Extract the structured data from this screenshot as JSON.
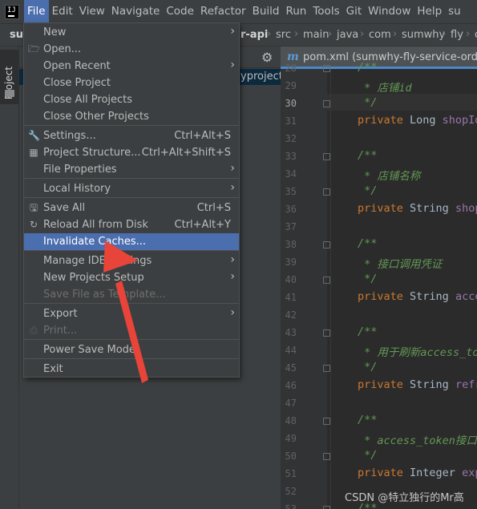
{
  "menubar": {
    "items": [
      "File",
      "Edit",
      "View",
      "Navigate",
      "Code",
      "Refactor",
      "Build",
      "Run",
      "Tools",
      "Git",
      "Window",
      "Help",
      "su"
    ],
    "active": "File"
  },
  "navbar": {
    "project": "su",
    "module": "r-api",
    "crumbs": [
      "src",
      "main",
      "java",
      "com",
      "sumwhy",
      "fly",
      "c"
    ]
  },
  "toolstrip": {
    "project_tab": "Project"
  },
  "project_panel": {
    "selected_row_text": "yproject\\"
  },
  "editor_tab": {
    "name": "pom.xml (sumwhy-fly-service-order-c"
  },
  "file_menu": {
    "items": [
      {
        "label": "New",
        "shortcut": "",
        "submenu": true,
        "icon": "",
        "disabled": false
      },
      {
        "label": "Open...",
        "shortcut": "",
        "submenu": false,
        "icon": "folder-icon",
        "disabled": false
      },
      {
        "label": "Open Recent",
        "shortcut": "",
        "submenu": true,
        "icon": "",
        "disabled": false
      },
      {
        "label": "Close Project",
        "shortcut": "",
        "submenu": false,
        "icon": "",
        "disabled": false
      },
      {
        "label": "Close All Projects",
        "shortcut": "",
        "submenu": false,
        "icon": "",
        "disabled": false
      },
      {
        "label": "Close Other Projects",
        "shortcut": "",
        "submenu": false,
        "icon": "",
        "disabled": false
      },
      {
        "label": "Settings...",
        "shortcut": "Ctrl+Alt+S",
        "submenu": false,
        "icon": "wrench-icon",
        "disabled": false
      },
      {
        "label": "Project Structure...",
        "shortcut": "Ctrl+Alt+Shift+S",
        "submenu": false,
        "icon": "project-structure-icon",
        "disabled": false
      },
      {
        "label": "File Properties",
        "shortcut": "",
        "submenu": true,
        "icon": "",
        "disabled": false
      },
      {
        "label": "Local History",
        "shortcut": "",
        "submenu": true,
        "icon": "",
        "disabled": false
      },
      {
        "label": "Save All",
        "shortcut": "Ctrl+S",
        "submenu": false,
        "icon": "save-icon",
        "disabled": false
      },
      {
        "label": "Reload All from Disk",
        "shortcut": "Ctrl+Alt+Y",
        "submenu": false,
        "icon": "reload-icon",
        "disabled": false
      },
      {
        "label": "Invalidate Caches...",
        "shortcut": "",
        "submenu": false,
        "icon": "",
        "disabled": false,
        "highlighted": true
      },
      {
        "label": "Manage IDE Settings",
        "shortcut": "",
        "submenu": true,
        "icon": "",
        "disabled": false
      },
      {
        "label": "New Projects Setup",
        "shortcut": "",
        "submenu": true,
        "icon": "",
        "disabled": false
      },
      {
        "label": "Save File as Template...",
        "shortcut": "",
        "submenu": false,
        "icon": "",
        "disabled": true
      },
      {
        "label": "Export",
        "shortcut": "",
        "submenu": true,
        "icon": "",
        "disabled": false
      },
      {
        "label": "Print...",
        "shortcut": "",
        "submenu": false,
        "icon": "print-icon",
        "disabled": true
      },
      {
        "label": "Power Save Mode",
        "shortcut": "",
        "submenu": false,
        "icon": "",
        "disabled": false
      },
      {
        "label": "Exit",
        "shortcut": "",
        "submenu": false,
        "icon": "",
        "disabled": false
      }
    ]
  },
  "editor": {
    "current_line": "30",
    "lines": [
      {
        "n": "28",
        "text": "/**",
        "kind": "doc"
      },
      {
        "n": "29",
        "text": " * 店铺id",
        "kind": "doc"
      },
      {
        "n": "30",
        "text": " */",
        "kind": "doc"
      },
      {
        "n": "31",
        "kw": "private ",
        "type": "Long ",
        "field": "shopId",
        "kind": "decl"
      },
      {
        "n": "32",
        "text": "",
        "kind": "blank"
      },
      {
        "n": "33",
        "text": "/**",
        "kind": "doc"
      },
      {
        "n": "34",
        "text": " * 店铺名称",
        "kind": "doc"
      },
      {
        "n": "35",
        "text": " */",
        "kind": "doc"
      },
      {
        "n": "36",
        "kw": "private ",
        "type": "String ",
        "field": "shop",
        "kind": "decl"
      },
      {
        "n": "37",
        "text": "",
        "kind": "blank"
      },
      {
        "n": "38",
        "text": "/**",
        "kind": "doc"
      },
      {
        "n": "39",
        "text": " * 接口调用凭证",
        "kind": "doc"
      },
      {
        "n": "40",
        "text": " */",
        "kind": "doc"
      },
      {
        "n": "41",
        "kw": "private ",
        "type": "String ",
        "field": "acce",
        "kind": "decl"
      },
      {
        "n": "42",
        "text": "",
        "kind": "blank"
      },
      {
        "n": "43",
        "text": "/**",
        "kind": "doc"
      },
      {
        "n": "44",
        "text": " * 用于刷新access_to",
        "kind": "doc"
      },
      {
        "n": "45",
        "text": " */",
        "kind": "doc"
      },
      {
        "n": "46",
        "kw": "private ",
        "type": "String ",
        "field": "refr",
        "kind": "decl"
      },
      {
        "n": "47",
        "text": "",
        "kind": "blank"
      },
      {
        "n": "48",
        "text": "/**",
        "kind": "doc"
      },
      {
        "n": "49",
        "text": " * access_token接口",
        "kind": "doc"
      },
      {
        "n": "50",
        "text": " */",
        "kind": "doc"
      },
      {
        "n": "51",
        "kw": "private ",
        "type": "Integer ",
        "field": "exp",
        "kind": "decl"
      },
      {
        "n": "52",
        "text": "",
        "kind": "blank"
      },
      {
        "n": "53",
        "text": "/**",
        "kind": "doc"
      }
    ]
  },
  "watermark": "CSDN @特立独行的Mr高",
  "colors": {
    "accent": "#4b6eaf",
    "annotation": "#e8443a"
  }
}
